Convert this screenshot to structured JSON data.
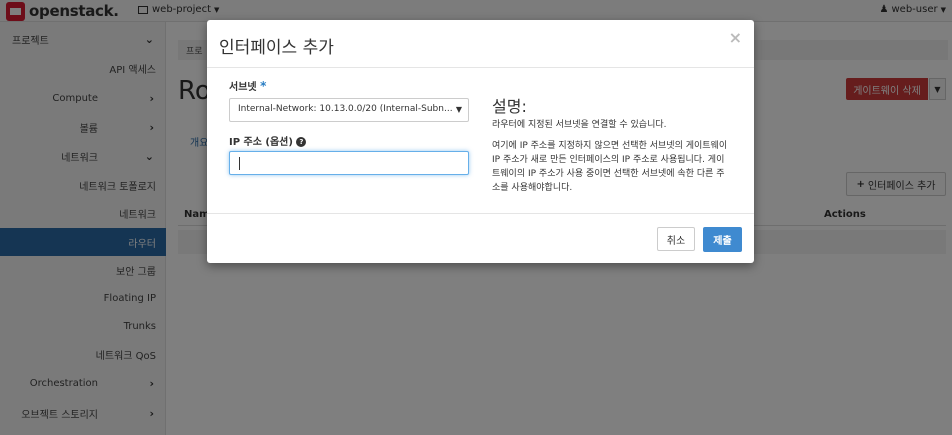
{
  "brand": {
    "name": "openstack."
  },
  "navbar": {
    "project": "web-project",
    "user": "web-user"
  },
  "sidebar": {
    "items": [
      {
        "label": "프로젝트"
      },
      {
        "label": "API 액세스"
      },
      {
        "label": "Compute"
      },
      {
        "label": "볼륨"
      },
      {
        "label": "네트워크"
      },
      {
        "label": "네트워크 토폴로지"
      },
      {
        "label": "네트워크"
      },
      {
        "label": "라우터"
      },
      {
        "label": "보안 그룹"
      },
      {
        "label": "Floating IP"
      },
      {
        "label": "Trunks"
      },
      {
        "label": "네트워크 QoS"
      },
      {
        "label": "Orchestration"
      },
      {
        "label": "오브젝트 스토리지"
      }
    ]
  },
  "page": {
    "breadcrumb": "프로",
    "title": "Ro",
    "delete_gateway": "게이트웨이 삭제",
    "tab_overview": "개요",
    "add_interface": "인터페이스 추가",
    "table_name_header": "Name",
    "table_actions_header": "Actions"
  },
  "modal": {
    "title": "인터페이스 추가",
    "close": "×",
    "subnet_label": "서브넷",
    "subnet_required": "*",
    "subnet_value": "Internal-Network: 10.13.0.0/20 (Internal-Subn...",
    "ip_label": "IP 주소 (옵션)",
    "ip_value": "",
    "description_title": "설명:",
    "description_p1": "라우터에 지정된 서브넷을 연결할 수 있습니다.",
    "description_p2": "여기에 IP 주소를 지정하지 않으면 선택한 서브넷의 게이트웨이 IP 주소가 새로 만든 인터페이스의 IP 주소로 사용됩니다. 게이트웨이의 IP 주소가 사용 중이면 선택한 서브넷에 속한 다른 주소를 사용해야합니다.",
    "cancel": "취소",
    "submit": "제출"
  },
  "colors": {
    "brand_red": "#da1a32",
    "active_nav": "#2a6aa6",
    "danger": "#cc3a3a",
    "primary": "#3f8ad0"
  }
}
